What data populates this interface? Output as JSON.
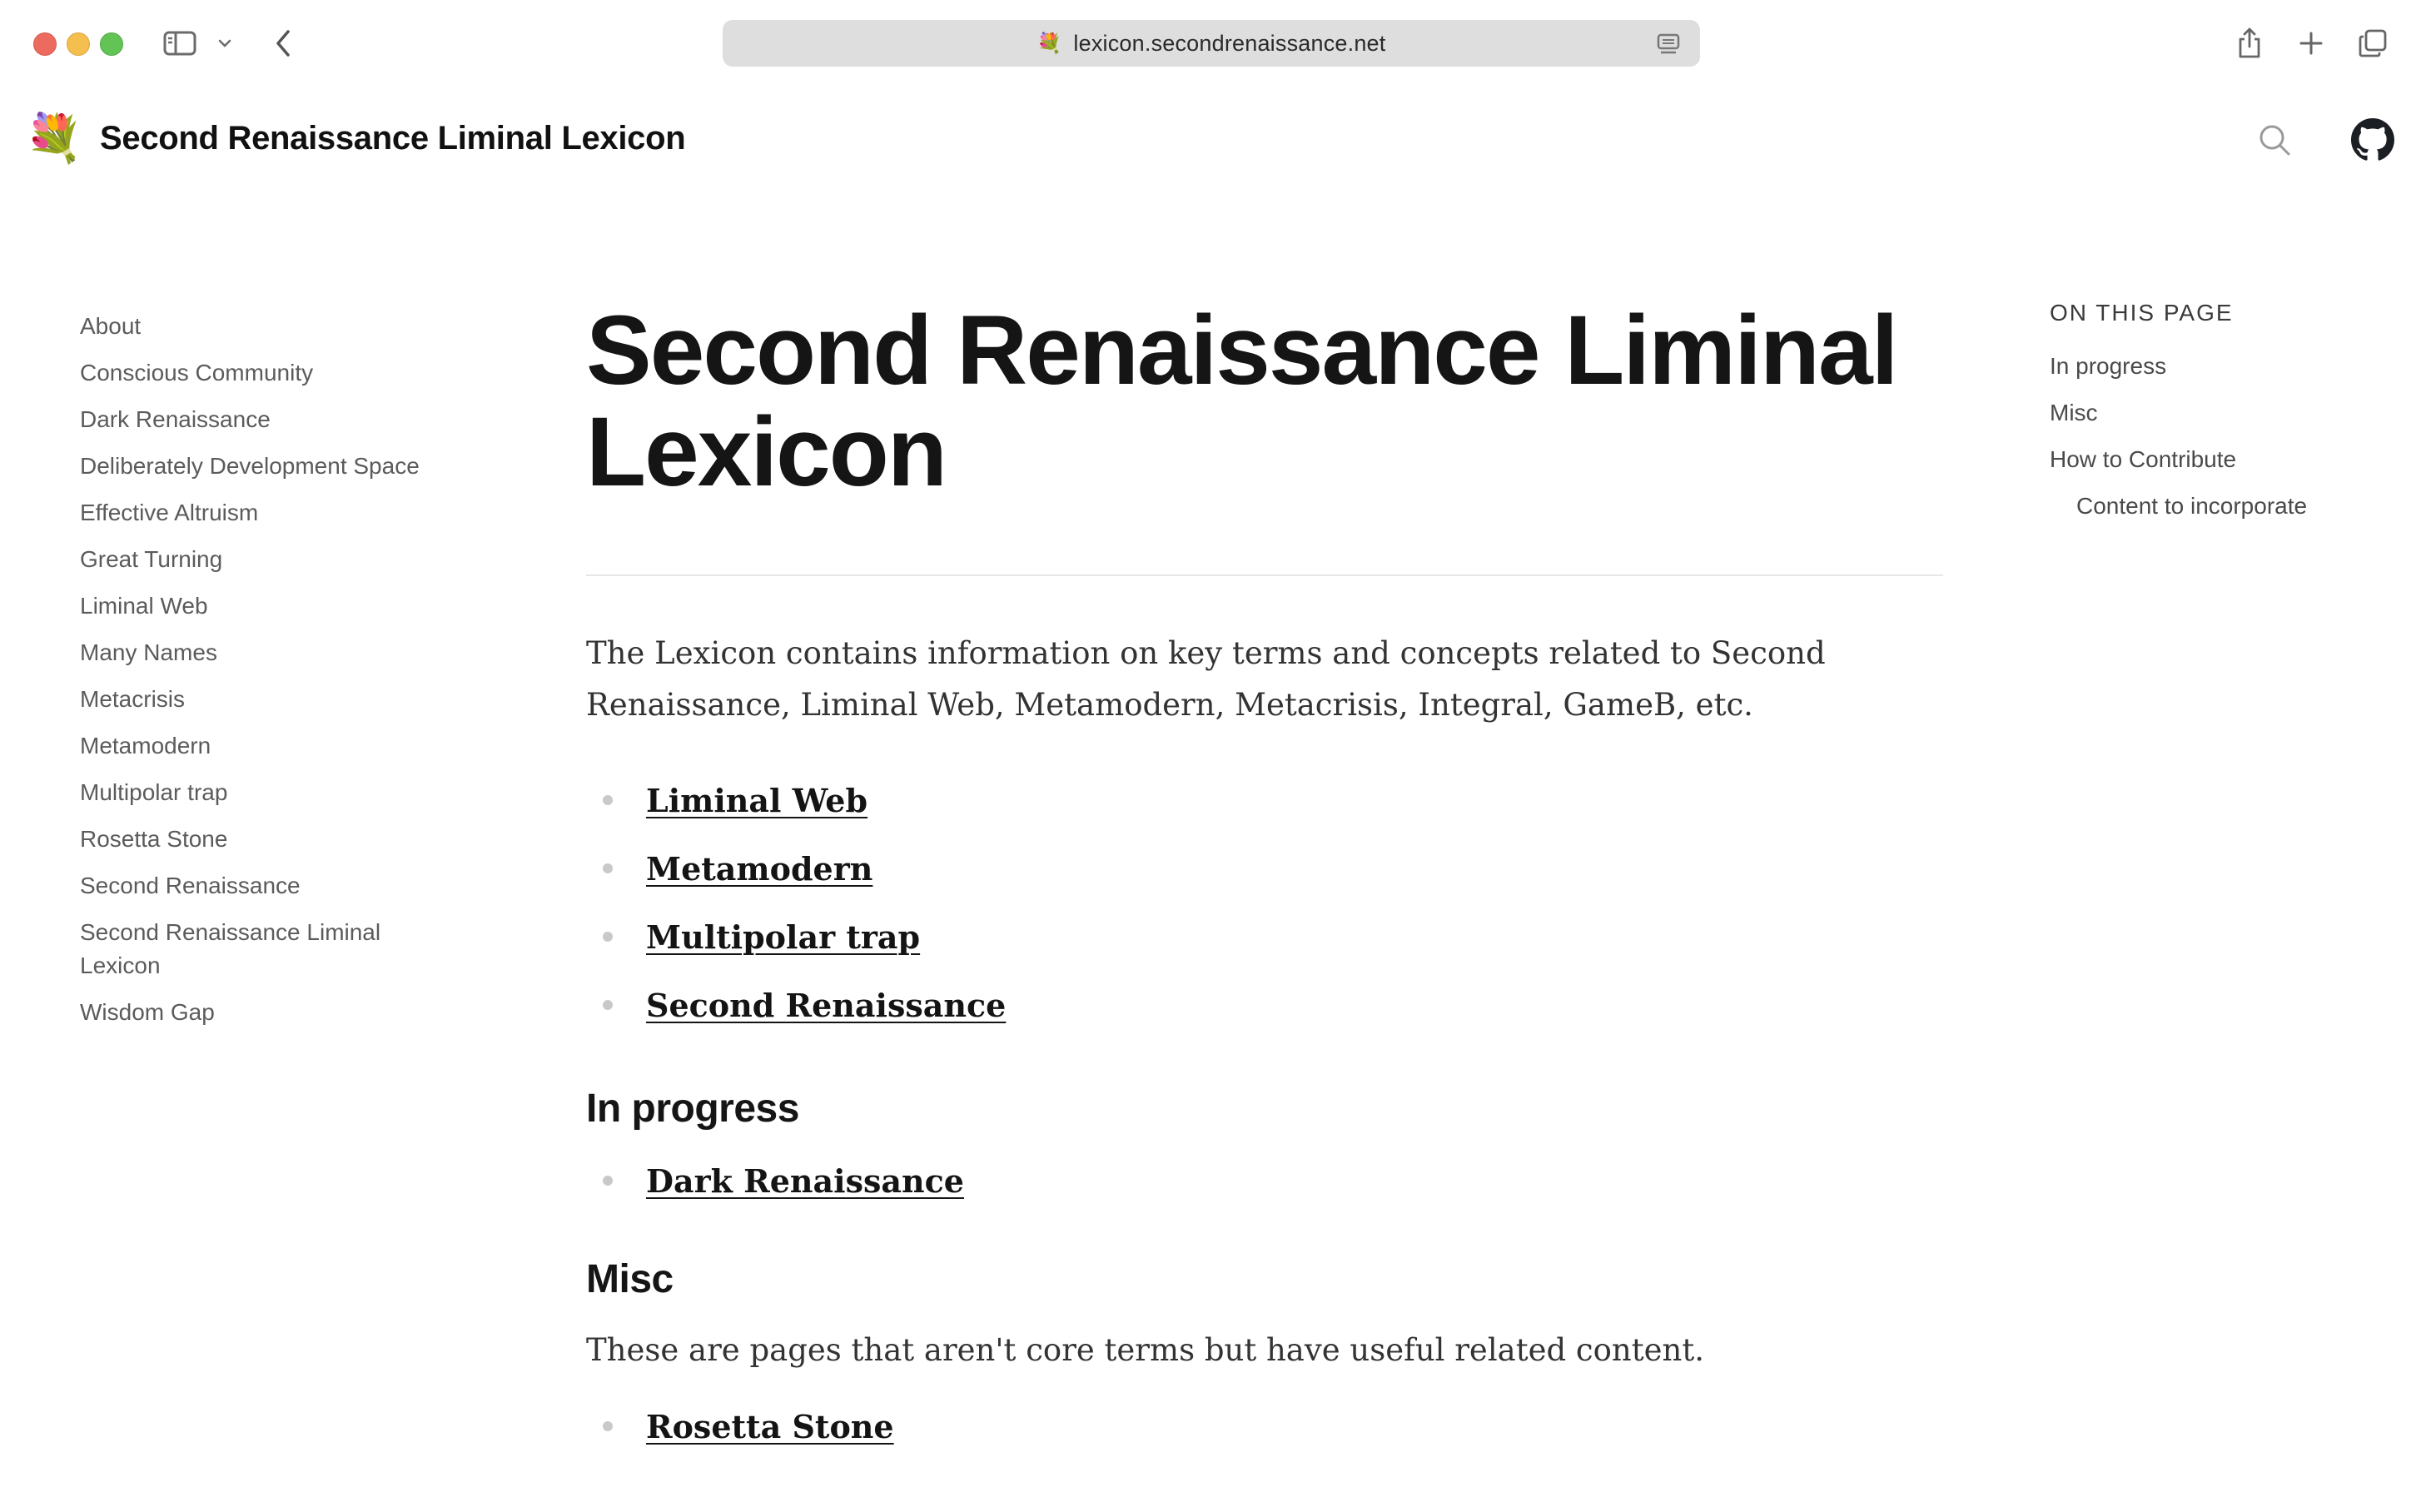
{
  "browser": {
    "url": "lexicon.secondrenaissance.net",
    "favicon": "💐"
  },
  "site": {
    "logo": "💐",
    "title": "Second Renaissance Liminal Lexicon"
  },
  "sidebar": {
    "items": [
      "About",
      "Conscious Community",
      "Dark Renaissance",
      "Deliberately Development Space",
      "Effective Altruism",
      "Great Turning",
      "Liminal Web",
      "Many Names",
      "Metacrisis",
      "Metamodern",
      "Multipolar trap",
      "Rosetta Stone",
      "Second Renaissance",
      "Second Renaissance Liminal Lexicon",
      "Wisdom Gap"
    ]
  },
  "main": {
    "title": "Second Renaissance Liminal Lexicon",
    "intro": "The Lexicon contains information on key terms and concepts related to Second Renaissance, Liminal Web, Metamodern, Metacrisis, Integral, GameB, etc.",
    "core_links": [
      "Liminal Web",
      "Metamodern",
      "Multipolar trap",
      "Second Renaissance"
    ],
    "in_progress": {
      "heading": "In progress",
      "links": [
        "Dark Renaissance"
      ]
    },
    "misc": {
      "heading": "Misc",
      "text": "These are pages that aren't core terms but have useful related content.",
      "links": [
        "Rosetta Stone"
      ]
    }
  },
  "toc": {
    "heading": "ON THIS PAGE",
    "items": [
      {
        "label": "In progress",
        "level": 1
      },
      {
        "label": "Misc",
        "level": 1
      },
      {
        "label": "How to Contribute",
        "level": 1
      },
      {
        "label": "Content to incorporate",
        "level": 2
      }
    ]
  }
}
